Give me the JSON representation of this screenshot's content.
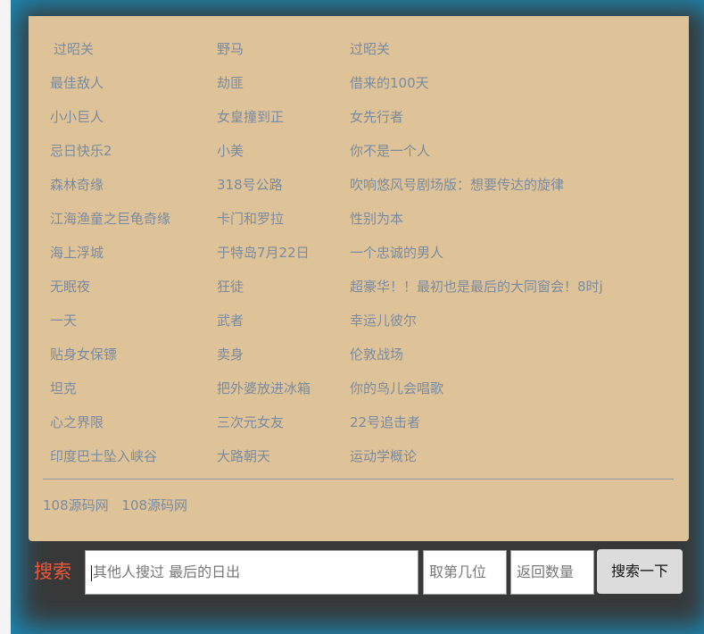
{
  "list": [
    [
      "过昭关",
      "野马",
      "过昭关"
    ],
    [
      "最佳敌人",
      "劫匪",
      "借来的100天"
    ],
    [
      "小小巨人",
      "女皇撞到正",
      "女先行者"
    ],
    [
      "忌日快乐2",
      "小美",
      "你不是一个人"
    ],
    [
      "森林奇缘",
      "318号公路",
      "吹响悠风号剧场版：想要传达的旋律"
    ],
    [
      "江海渔童之巨龟奇缘",
      "卡门和罗拉",
      "性别为本"
    ],
    [
      "海上浮城",
      "于特岛7月22日",
      "一个忠诚的男人"
    ],
    [
      "无眠夜",
      "狂徒",
      "超豪华！！最初也是最后的大同窗会！8时j"
    ],
    [
      "一天",
      "武者",
      "幸运儿彼尔"
    ],
    [
      "贴身女保镖",
      "卖身",
      "伦敦战场"
    ],
    [
      "坦克",
      "把外婆放进冰箱",
      "你的鸟儿会唱歌"
    ],
    [
      "心之界限",
      "三次元女友",
      "22号追击者"
    ],
    [
      "印度巴士坠入峡谷",
      "大路朝天",
      "运动学概论"
    ]
  ],
  "footer_links": [
    "108源码网",
    "108源码网"
  ],
  "search": {
    "label": "搜索",
    "query_placeholder": "其他人搜过 最后的日出",
    "offset_placeholder": "取第几位",
    "count_placeholder": "返回数量",
    "button": "搜索一下"
  }
}
